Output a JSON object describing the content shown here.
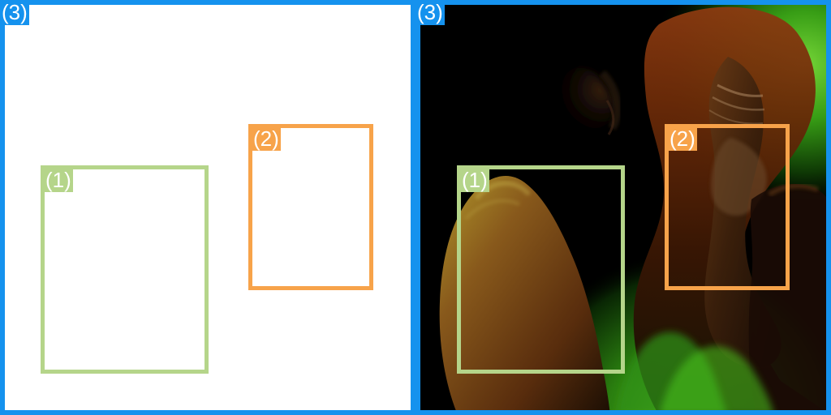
{
  "colors": {
    "page_background": "#ffffff",
    "blue": "#1592ee",
    "green": "#b5d58a",
    "orange": "#f7a34a"
  },
  "panels": {
    "left": {
      "region_label": "(3)",
      "boxes": [
        {
          "label": "(1)",
          "color": "#b5d58a"
        },
        {
          "label": "(2)",
          "color": "#f7a34a"
        }
      ]
    },
    "right": {
      "region_label": "(3)",
      "boxes": [
        {
          "label": "(1)",
          "color": "#b5d58a"
        },
        {
          "label": "(2)",
          "color": "#f7a34a"
        }
      ]
    }
  }
}
